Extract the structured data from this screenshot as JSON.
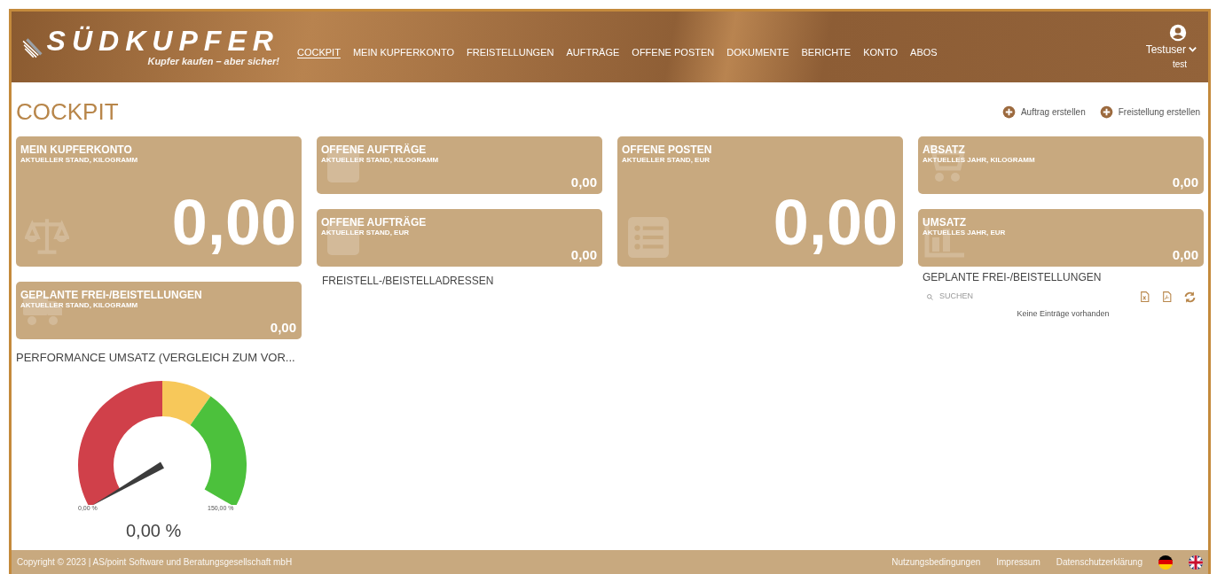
{
  "header": {
    "logo_title": "SÜDKUPFER",
    "logo_slogan": "Kupfer kaufen – aber sicher!",
    "nav": [
      {
        "label": "COCKPIT",
        "selected": true
      },
      {
        "label": "MEIN KUPFERKONTO",
        "selected": false
      },
      {
        "label": "FREISTELLUNGEN",
        "selected": false
      },
      {
        "label": "AUFTRÄGE",
        "selected": false
      },
      {
        "label": "OFFENE POSTEN",
        "selected": false
      },
      {
        "label": "DOKUMENTE",
        "selected": false
      },
      {
        "label": "BERICHTE",
        "selected": false
      },
      {
        "label": "KONTO",
        "selected": false
      },
      {
        "label": "ABOS",
        "selected": false
      }
    ],
    "user": {
      "name": "Testuser",
      "sub": "test"
    }
  },
  "page_title": "COCKPIT",
  "actions": [
    "Auftrag erstellen",
    "Freistellung erstellen"
  ],
  "columns": [
    {
      "items": [
        {
          "kind": "big_tile",
          "title": "MEIN KUPFERKONTO",
          "subtitle": "AKTUELLER STAND, KILOGRAMM",
          "value": "0,00"
        },
        {
          "kind": "small_tile",
          "title": "GEPLANTE FREI-/BEISTELLUNGEN",
          "subtitle": "AKTUELLER STAND, KILOGRAMM",
          "value": "0,00"
        },
        {
          "kind": "gauge",
          "title": "PERFORMANCE UMSATZ (VERGLEICH ZUM VOR...",
          "min_label": "0,00 %",
          "max_label": "150,00 %",
          "value": "0,00 %"
        }
      ]
    },
    {
      "items": [
        {
          "kind": "small_tile",
          "title": "OFFENE AUFTRÄGE",
          "subtitle": "AKTUELLER STAND, KILOGRAMM",
          "value": "0,00"
        },
        {
          "kind": "small_tile",
          "title": "OFFENE AUFTRÄGE",
          "subtitle": "AKTUELLER STAND, EUR",
          "value": "0,00"
        },
        {
          "kind": "heading",
          "title": "FREISTELL-/BEISTELLADRESSEN"
        }
      ]
    },
    {
      "items": [
        {
          "kind": "big_tile",
          "title": "OFFENE POSTEN",
          "subtitle": "AKTUELLER STAND, EUR",
          "value": "0,00"
        }
      ]
    },
    {
      "items": [
        {
          "kind": "small_tile",
          "title": "ABSATZ",
          "subtitle": "AKTUELLES JAHR, KILOGRAMM",
          "value": "0,00"
        },
        {
          "kind": "small_tile",
          "title": "UMSATZ",
          "subtitle": "AKTUELLES JAHR, EUR",
          "value": "0,00"
        },
        {
          "kind": "table",
          "title": "GEPLANTE FREI-/BEISTELLUNGEN",
          "search_placeholder": "SUCHEN",
          "empty_text": "Keine Einträge vorhanden"
        }
      ]
    }
  ],
  "footer": {
    "copyright": "Copyright © 2023 | AS/point Software und Beratungsgesellschaft mbH",
    "links": [
      "Nutzungsbedingungen",
      "Impressum",
      "Datenschutzerklärung"
    ]
  }
}
